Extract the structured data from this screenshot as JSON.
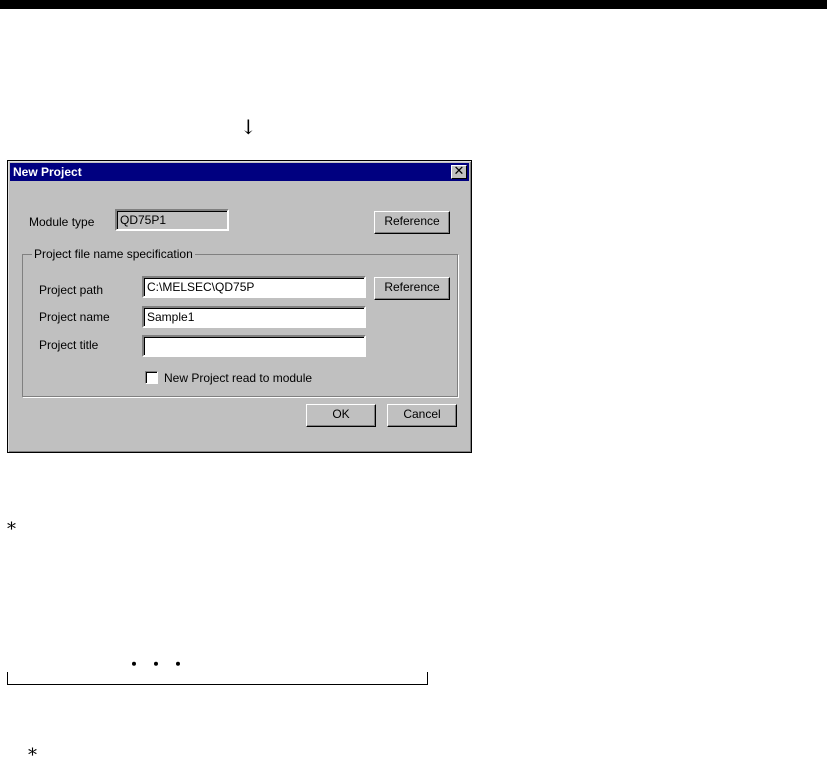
{
  "page": {
    "arrow": "↓",
    "note_marker_1": "*",
    "ellipsis": "・・・",
    "note_marker_2": "*"
  },
  "dialog": {
    "title": "New Project",
    "close_symbol": "✕",
    "module_type_label": "Module type",
    "module_type_value": "QD75P1",
    "reference_button_1": "Reference",
    "group_title": "Project file name specification",
    "project_path_label": "Project path",
    "project_path_value": "C:\\MELSEC\\QD75P",
    "reference_button_2": "Reference",
    "project_name_label": "Project name",
    "project_name_value": "Sample1",
    "project_title_label": "Project title",
    "project_title_value": "",
    "checkbox_label": "New Project read to module",
    "checkbox_checked": false,
    "ok_button": "OK",
    "cancel_button": "Cancel"
  }
}
